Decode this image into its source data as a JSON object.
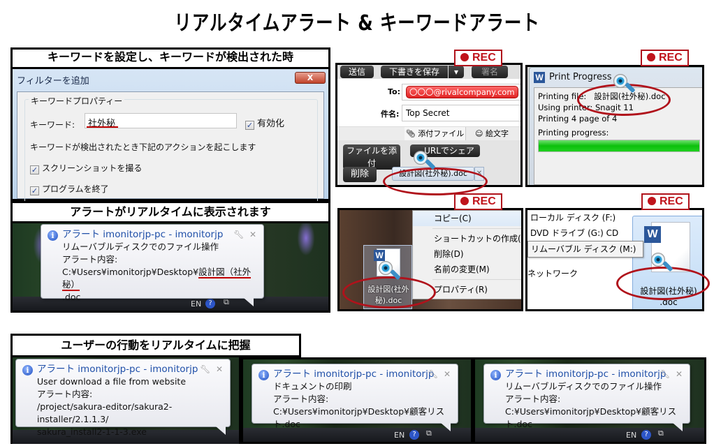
{
  "page": {
    "title": "リアルタイムアラート & キーワードアラート"
  },
  "captions": {
    "keyword_set": "キーワードを設定し、キーワードが検出された時",
    "alert_realtime": "アラートがリアルタイムに表示されます",
    "user_actions": "ユーザーの行動をリアルタイムに把握"
  },
  "rec_badge": {
    "label": "REC",
    "color": "#c0141c"
  },
  "filter_dialog": {
    "title": "フィルターを追加",
    "close_label": "X",
    "group_label": "キーワードプロパティー",
    "keyword_label": "キーワード:",
    "keyword_value": "社外秘",
    "enable_label": "有効化",
    "enable_checked": true,
    "actions_intro": "キーワードが検出されたとき下記のアクションを起こします",
    "actions": [
      {
        "label": "スクリーンショットを撮る",
        "checked": true
      },
      {
        "label": "プログラムを終了",
        "checked": true
      }
    ]
  },
  "alert_keyword": {
    "title": "アラート imonitorjp-pc - imonitorjp",
    "line1": "リムーバブルディスクでのファイル操作",
    "line2": "アラート内容:",
    "path_prefix": "C:¥Users¥imonitorjp¥Desktop¥",
    "path_highlight": "設計図（社外秘）",
    "path_suffix": ".doc",
    "taskbar_lang": "EN"
  },
  "email": {
    "toolbar": [
      "送信",
      "下書きを保存",
      "▾",
      "署名"
    ],
    "to_label": "To:",
    "to_value": "〇〇〇@rivalcompany.com",
    "subject_label": "件名:",
    "subject_value": "Top Secret",
    "tabs": [
      "添付ファイル",
      "絵文字"
    ],
    "attach_button": "ファイルを添付",
    "share_button": "URLでシェア",
    "delete_button": "削除",
    "attachment": "設計図(社外秘).doc"
  },
  "print": {
    "title": "Print Progress",
    "file_label": "Printing file:",
    "file_value": "設計図(社外秘).doc",
    "printer": "Using printer:  Snagit 11",
    "pages": "Printing 4 page of 4",
    "progress_label": "Printing progress:",
    "progress": 1.0
  },
  "desktop_ctx": {
    "menu": [
      "コピー(C)",
      "ショートカットの作成(S)",
      "削除(D)",
      "名前の変更(M)",
      "プロパティ(R)"
    ],
    "file_line1": "設計図(社外",
    "file_line2": "秘).doc"
  },
  "explorer": {
    "items": [
      "ローカル ディスク (F:)",
      "DVD ドライブ (G:) CD",
      "リムーバブル ディスク (M:)",
      "ネットワーク"
    ],
    "file_line1": "設計図(社外秘)",
    "file_line2": ".doc"
  },
  "bottom_alerts": [
    {
      "title": "アラート imonitorjp-pc - imonitorjp",
      "line1": "User download a file from website",
      "line2": "アラート内容:",
      "line3": "/project/sakura-editor/sakura2-installer/2.1.1.3/",
      "line4": "sakura_install2-1-1-3.exe"
    },
    {
      "title": "アラート imonitorjp-pc - imonitorjp",
      "line1": "ドキュメントの印刷",
      "line2": "アラート内容:",
      "line3": "C:¥Users¥imonitorjp¥Desktop¥顧客リスト.doc"
    },
    {
      "title": "アラート imonitorjp-pc - imonitorjp",
      "line1": "リムーバブルディスクでのファイル操作",
      "line2": "アラート内容:",
      "line3": "C:¥Users¥imonitorjp¥Desktop¥顧客リスト.doc"
    }
  ],
  "taskbar_lang": "EN"
}
